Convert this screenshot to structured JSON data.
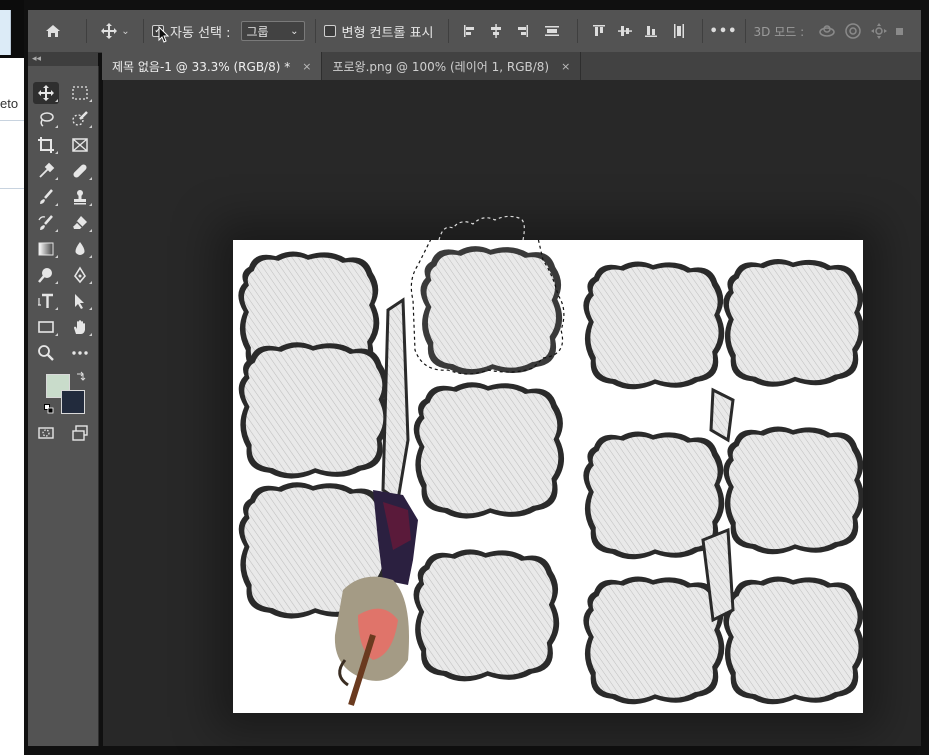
{
  "options_bar": {
    "auto_select_label": "자동 선택 :",
    "auto_select_checked": true,
    "target_select": "그룹",
    "transform_controls_label": "변형 컨트롤 표시",
    "transform_controls_checked": false,
    "more_label": "•••",
    "mode3d_label": "3D 모드 :"
  },
  "tabs": [
    {
      "title": "제목 없음-1 @ 33.3% (RGB/8) *",
      "active": true
    },
    {
      "title": "포로왕.png @ 100% (레이어 1, RGB/8)",
      "active": false
    }
  ],
  "tab_close_glyph": "×",
  "toolbar": {
    "collapse_glyph": "◂◂",
    "foreground_color": "#c9dccb",
    "background_color": "#222b3d"
  },
  "bg_window_fragment": "eto",
  "colors": {
    "options_bg": "#535353",
    "workspace_bg": "#282828",
    "canvas_bg": "#ffffff"
  }
}
